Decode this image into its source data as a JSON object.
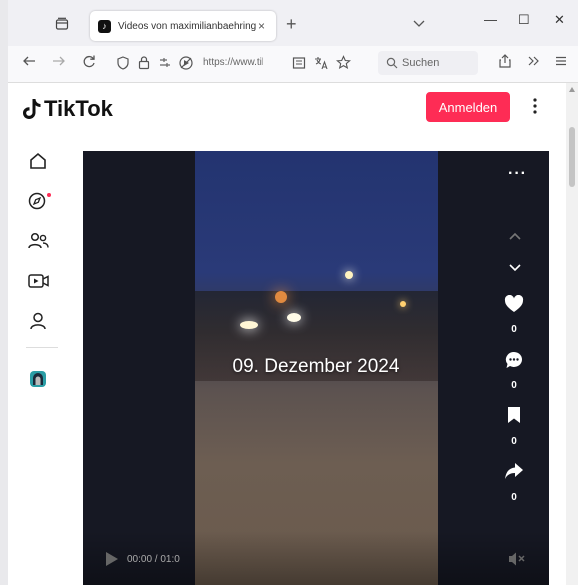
{
  "browser": {
    "tab_title": "Videos von maximilianbaehring",
    "tab_close": "×",
    "new_tab": "+",
    "url": "https://www.tik",
    "search_placeholder": "Suchen",
    "window": {
      "minimize": "—",
      "maximize": "☐",
      "close": "✕"
    }
  },
  "page": {
    "logo_text": "TikTok",
    "login_label": "Anmelden",
    "sidebar": [
      {
        "icon": "home-icon"
      },
      {
        "icon": "explore-icon"
      },
      {
        "icon": "following-icon"
      },
      {
        "icon": "live-icon"
      },
      {
        "icon": "profile-icon"
      },
      {
        "icon": "user-avatar"
      }
    ],
    "video": {
      "overlay_text": "09. Dezember 2024",
      "more": "···",
      "likes": "0",
      "comments": "0",
      "saves": "0",
      "shares": "0",
      "time": "00:00 / 01:0"
    }
  },
  "colors": {
    "accent": "#fe2c55",
    "video_bg": "#161823"
  }
}
